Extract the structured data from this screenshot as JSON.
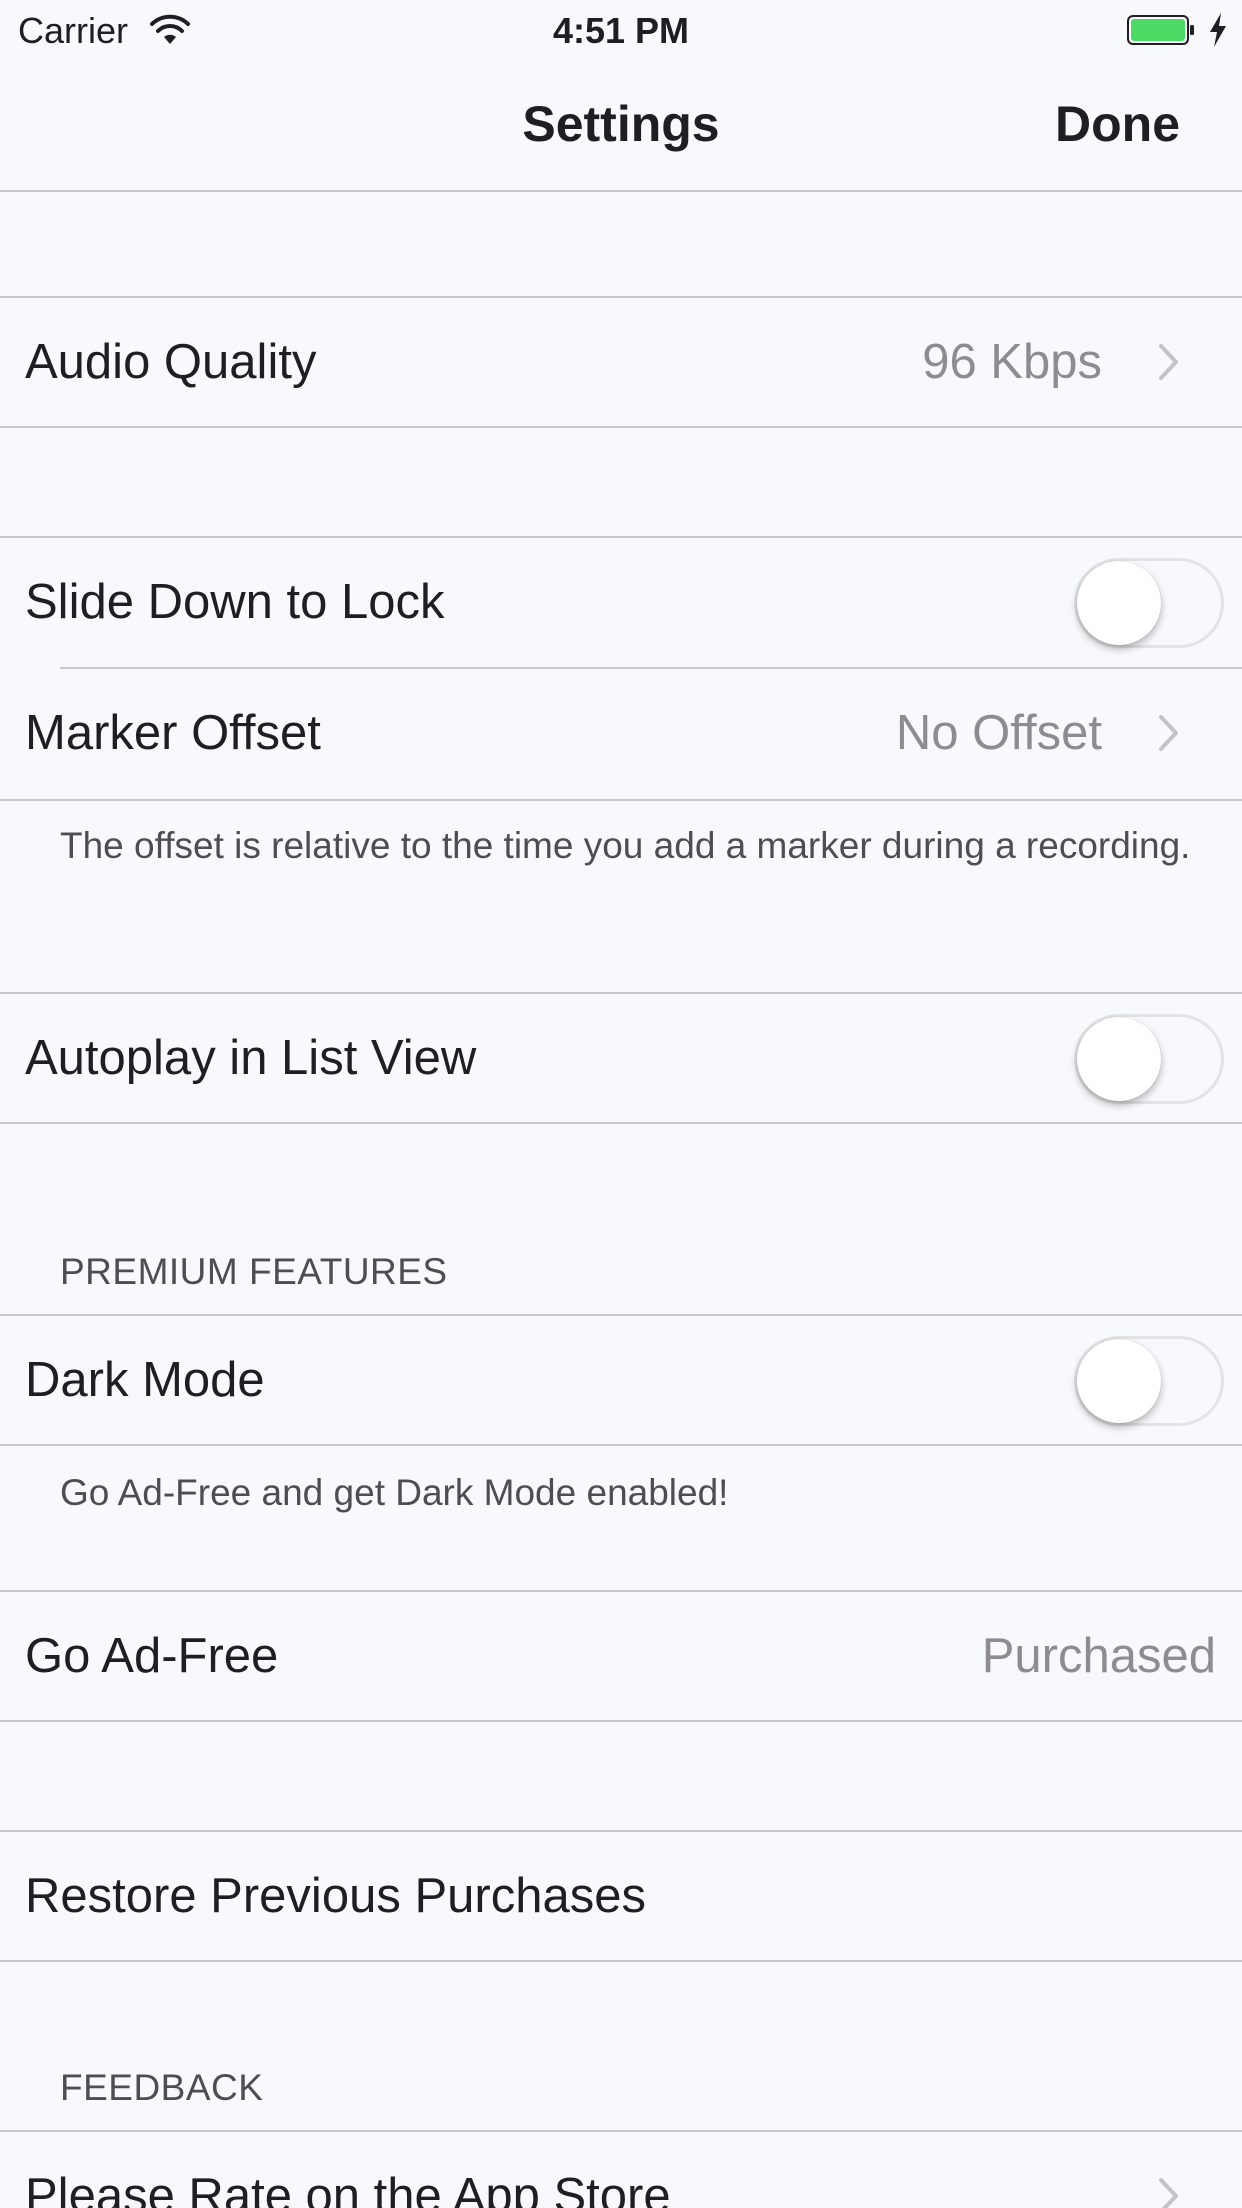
{
  "status_bar": {
    "carrier": "Carrier",
    "time": "4:51 PM",
    "battery_color": "#4cd964"
  },
  "nav": {
    "title": "Settings",
    "done_label": "Done"
  },
  "audio_quality": {
    "label": "Audio Quality",
    "value": "96 Kbps"
  },
  "slide_down_lock": {
    "label": "Slide Down to Lock",
    "enabled": false
  },
  "marker_offset": {
    "label": "Marker Offset",
    "value": "No Offset"
  },
  "offset_footer": "The offset is relative to the time you add a marker during a recording.",
  "autoplay": {
    "label": "Autoplay in List View",
    "enabled": false
  },
  "premium_header": "PREMIUM FEATURES",
  "dark_mode": {
    "label": "Dark Mode",
    "enabled": false
  },
  "dark_mode_footer": "Go Ad-Free and get Dark Mode enabled!",
  "go_ad_free": {
    "label": "Go Ad-Free",
    "value": "Purchased"
  },
  "restore": {
    "label": "Restore Previous Purchases"
  },
  "feedback_header": "FEEDBACK",
  "rate": {
    "label": "Please Rate on the App Store"
  },
  "icons": {
    "wifi": "wifi-icon",
    "battery": "battery-icon",
    "charging": "charging-bolt-icon",
    "chevron": "chevron-right-icon"
  }
}
